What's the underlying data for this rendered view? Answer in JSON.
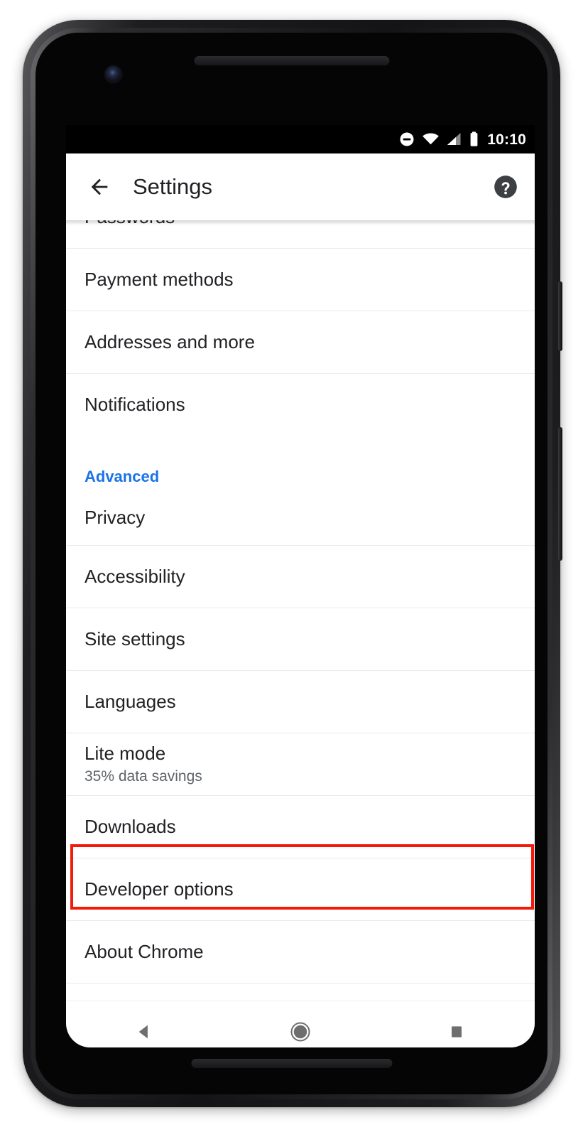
{
  "statusbar": {
    "clock": "10:10",
    "icons": [
      {
        "name": "do-not-disturb-icon",
        "glyph": "dnd"
      },
      {
        "name": "wifi-icon",
        "glyph": "wifi"
      },
      {
        "name": "cell-signal-icon",
        "glyph": "signal"
      },
      {
        "name": "battery-icon",
        "glyph": "battery"
      }
    ]
  },
  "toolbar": {
    "back_label": "Back",
    "title": "Settings",
    "help_label": "Help & feedback",
    "back_icon": "arrow-left-icon",
    "help_icon": "help-circle-icon"
  },
  "settings": {
    "items": [
      {
        "title": "Passwords",
        "subtitle": ""
      },
      {
        "title": "Payment methods",
        "subtitle": ""
      },
      {
        "title": "Addresses and more",
        "subtitle": ""
      },
      {
        "title": "Notifications",
        "subtitle": ""
      }
    ],
    "advanced_header": "Advanced",
    "advanced_items": [
      {
        "title": "Privacy",
        "subtitle": ""
      },
      {
        "title": "Accessibility",
        "subtitle": ""
      },
      {
        "title": "Site settings",
        "subtitle": ""
      },
      {
        "title": "Languages",
        "subtitle": ""
      },
      {
        "title": "Lite mode",
        "subtitle": "35% data savings"
      },
      {
        "title": "Downloads",
        "subtitle": ""
      },
      {
        "title": "Developer options",
        "subtitle": ""
      },
      {
        "title": "About Chrome",
        "subtitle": ""
      }
    ]
  },
  "navbar": {
    "back": "Back",
    "home": "Home",
    "recents": "Recent apps"
  },
  "colors": {
    "accent_blue": "#1a73e8",
    "annotation_red": "#f21b09",
    "primary_text": "#202124",
    "secondary_text": "#5f6368",
    "divider": "#e8eaed",
    "nav_icon": "#6e6e6e"
  }
}
